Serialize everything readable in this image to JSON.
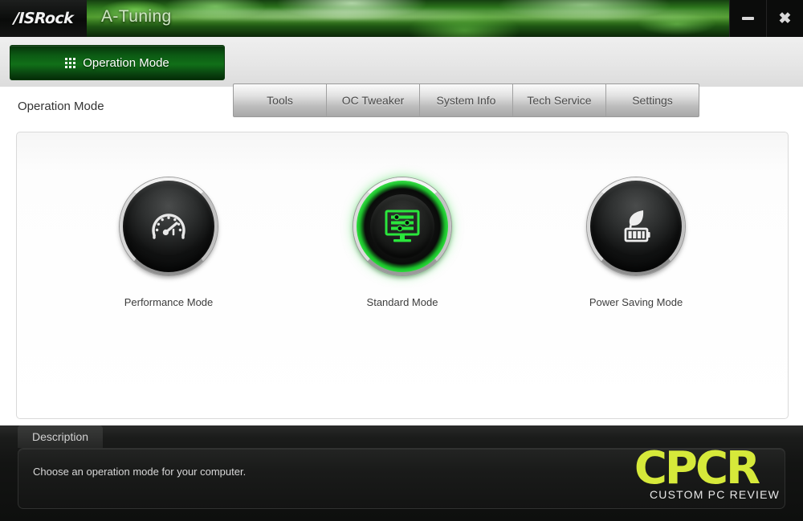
{
  "window": {
    "brand": "/ISRock",
    "app_title": "A-Tuning",
    "minimize_label": "Minimize",
    "close_label": "Close",
    "minimize_icon": "minimize-icon",
    "close_icon": "close-icon"
  },
  "tabs": {
    "active": {
      "label": "Operation Mode",
      "icon": "grid-icon"
    },
    "items": [
      {
        "label": "Tools"
      },
      {
        "label": "OC Tweaker"
      },
      {
        "label": "System Info"
      },
      {
        "label": "Tech Service"
      },
      {
        "label": "Settings"
      }
    ]
  },
  "page": {
    "title": "Operation Mode"
  },
  "modes": [
    {
      "label": "Performance Mode",
      "icon": "speedometer-icon",
      "selected": false
    },
    {
      "label": "Standard Mode",
      "icon": "monitor-sliders-icon",
      "selected": true
    },
    {
      "label": "Power Saving Mode",
      "icon": "leaf-battery-icon",
      "selected": false
    }
  ],
  "footer": {
    "section_label": "Description",
    "description": "Choose an operation mode for your computer."
  },
  "watermark": {
    "main": "CPCR",
    "sub": "CUSTOM PC REVIEW"
  },
  "colors": {
    "accent_green": "#117018",
    "selected_ring": "#2ae63c",
    "banner_green": "#4f9c2c",
    "watermark_yellow": "#d6e93a",
    "footer_dark": "#131413"
  }
}
